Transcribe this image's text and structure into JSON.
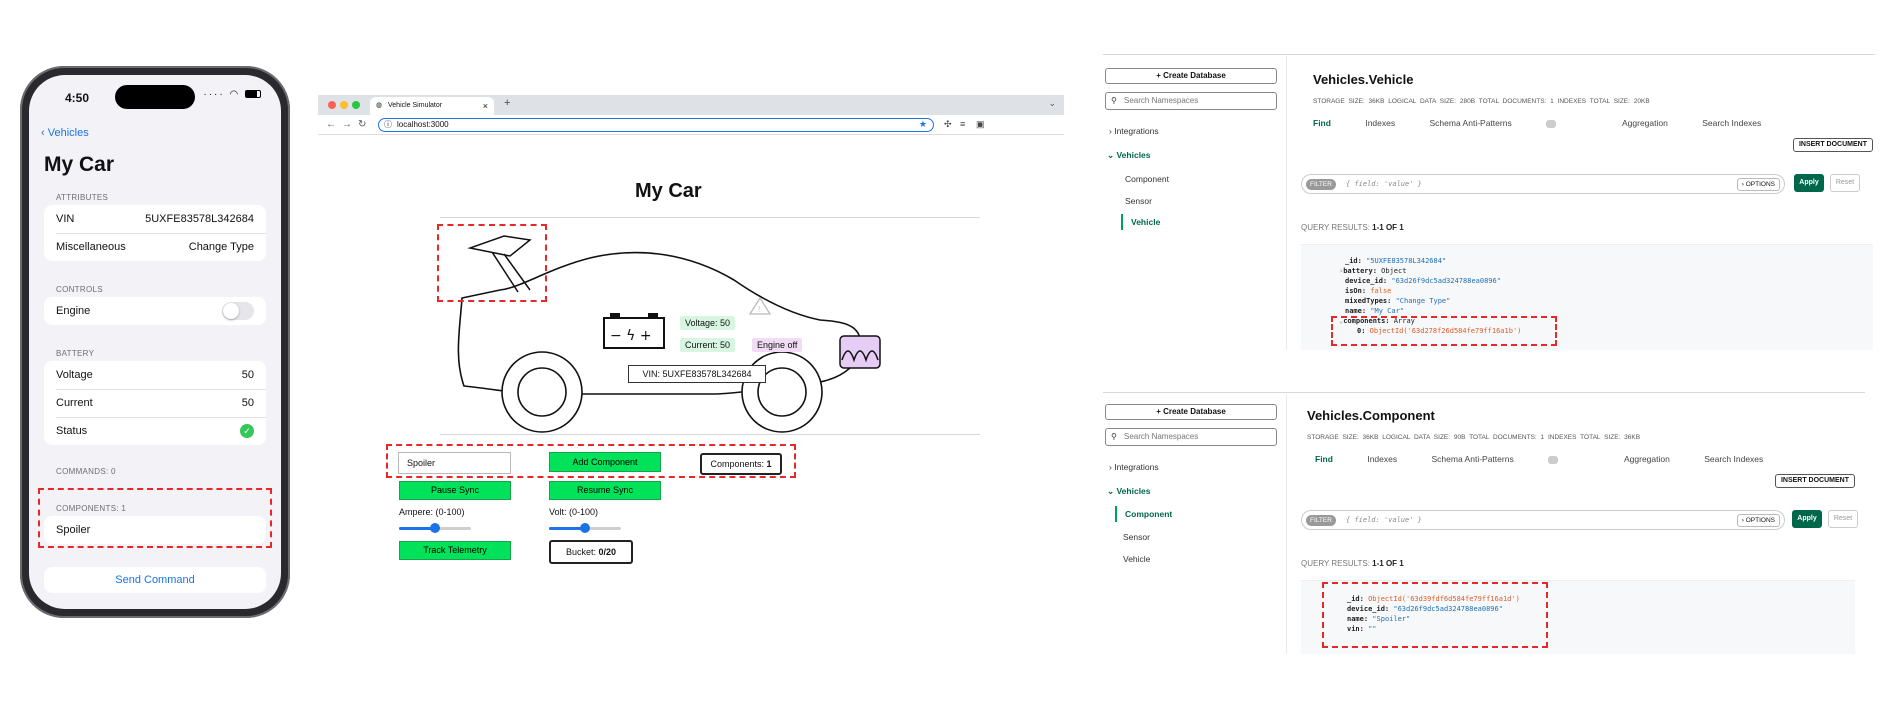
{
  "phone": {
    "time": "4:50",
    "back_label": "Vehicles",
    "title": "My Car",
    "attributes": {
      "header": "ATTRIBUTES",
      "vin_label": "VIN",
      "vin_value": "5UXFE83578L342684",
      "misc_label": "Miscellaneous",
      "misc_value": "Change Type"
    },
    "controls": {
      "header": "CONTROLS",
      "engine_label": "Engine",
      "engine_on": false
    },
    "battery": {
      "header": "BATTERY",
      "voltage_label": "Voltage",
      "voltage_value": "50",
      "current_label": "Current",
      "current_value": "50",
      "status_label": "Status"
    },
    "commands_header": "COMMANDS: 0",
    "components_header": "COMPONENTS: 1",
    "components": [
      "Spoiler"
    ],
    "send_label": "Send Command"
  },
  "browser": {
    "tab_title": "Vehicle Simulator",
    "url": "localhost:3000"
  },
  "simulator": {
    "title": "My Car",
    "voltage_chip": "Voltage: 50",
    "current_chip": "Current: 50",
    "engine_chip": "Engine off",
    "vin_label": "VIN: 5UXFE83578L342684",
    "component_input": "Spoiler",
    "add_component": "Add Component",
    "components_label": "Components:",
    "components_count": "1",
    "pause_sync": "Pause Sync",
    "resume_sync": "Resume Sync",
    "ampere_label": "Ampere: (0-100)",
    "ampere_value": 50,
    "volt_label": "Volt: (0-100)",
    "volt_value": 50,
    "track_telemetry": "Track Telemetry",
    "bucket_label": "Bucket:",
    "bucket_value": "0/20"
  },
  "atlas_vehicle": {
    "create_db": "Create Database",
    "search_ph": "Search Namespaces",
    "sidebar": [
      "Integrations",
      "Vehicles",
      "Component",
      "Sensor",
      "Vehicle"
    ],
    "collection": "Vehicles.Vehicle",
    "stats": "STORAGE SIZE: 36KB    LOGICAL DATA SIZE: 280B    TOTAL DOCUMENTS: 1    INDEXES TOTAL SIZE: 20KB",
    "tabs": [
      "Find",
      "Indexes",
      "Schema Anti-Patterns",
      "Aggregation",
      "Search Indexes"
    ],
    "schema_badge": "0",
    "insert_doc": "INSERT DOCUMENT",
    "filter_tag": "FILTER",
    "filter_ph": "{ field: 'value' }",
    "options": "OPTIONS",
    "apply": "Apply",
    "reset": "Reset",
    "results_label": "QUERY RESULTS:",
    "results_value": "1-1 OF 1",
    "doc": {
      "id_key": "_id:",
      "id_val": "\"5UXFE83578L342684\"",
      "battery_key": "battery:",
      "battery_val": "Object",
      "device_key": "device_id:",
      "device_val": "\"63d26f9dc5ad324788ea0896\"",
      "ison_key": "isOn:",
      "ison_val": "false",
      "mixed_key": "mixedTypes:",
      "mixed_val": "\"Change Type\"",
      "name_key": "name:",
      "name_val": "\"My Car\"",
      "comp_key": "components:",
      "comp_val": "Array",
      "comp0_key": "0:",
      "comp0_val": "ObjectId('63d278f26d584fe79ff16a1b')"
    }
  },
  "atlas_component": {
    "create_db": "Create Database",
    "search_ph": "Search Namespaces",
    "sidebar": [
      "Integrations",
      "Vehicles",
      "Component",
      "Sensor",
      "Vehicle"
    ],
    "collection": "Vehicles.Component",
    "stats": "STORAGE SIZE: 36KB    LOGICAL DATA SIZE: 90B    TOTAL DOCUMENTS: 1    INDEXES TOTAL SIZE: 36KB",
    "tabs": [
      "Find",
      "Indexes",
      "Schema Anti-Patterns",
      "Aggregation",
      "Search Indexes"
    ],
    "schema_badge": "0",
    "insert_doc": "INSERT DOCUMENT",
    "filter_tag": "FILTER",
    "filter_ph": "{ field: 'value' }",
    "options": "OPTIONS",
    "apply": "Apply",
    "reset": "Reset",
    "results_label": "QUERY RESULTS:",
    "results_value": "1-1 OF 1",
    "doc": {
      "id_key": "_id:",
      "id_val": "ObjectId('63d39fdf6d584fe79ff16a1d')",
      "device_key": "device_id:",
      "device_val": "\"63d26f9dc5ad324788ea0896\"",
      "name_key": "name:",
      "name_val": "\"Spoiler\"",
      "vin_key": "vin:",
      "vin_val": "\"\""
    }
  },
  "colors": {
    "highlight": "#e52828",
    "ios_blue": "#1a73e8",
    "sim_green": "#00e25a",
    "atlas_green": "#00684a"
  }
}
